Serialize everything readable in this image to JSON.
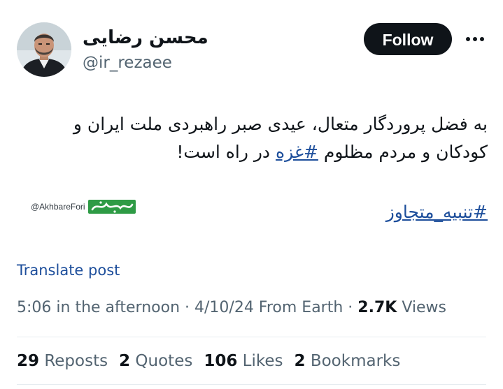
{
  "author": {
    "display_name": "محسن رضایی",
    "handle": "@ir_rezaee"
  },
  "header": {
    "follow_label": "Follow",
    "more_icon": "ellipsis-icon"
  },
  "tweet": {
    "line1": "به فضل پروردگار متعال، عیدی صبر راهبردی ملت ایران و",
    "line2_before": "کودکان و مردم مظلوم",
    "line2_hashtag": "#غزه",
    "line2_after": "در راه است!",
    "hashtag_line": "#تنبیه_متجاوز"
  },
  "watermark": {
    "handle": "@AkhbareFori",
    "logo_text": "خبرفوری",
    "logo_color": "#2e9b45"
  },
  "translate_label": "Translate post",
  "meta": {
    "time": "5:06 in the afternoon",
    "sep1": " · ",
    "date": "4/10/24",
    "source": " From Earth",
    "sep2": " · ",
    "views_count": "2.7K",
    "views_label": " Views"
  },
  "stats": [
    {
      "count": "29",
      "label": " Reposts"
    },
    {
      "count": "2",
      "label": " Quotes"
    },
    {
      "count": "106",
      "label": " Likes"
    },
    {
      "count": "2",
      "label": " Bookmarks"
    }
  ],
  "colors": {
    "link": "#1d4e9b",
    "secondary_text": "#536471",
    "primary_text": "#0f1419",
    "follow_bg": "#0f1419"
  }
}
